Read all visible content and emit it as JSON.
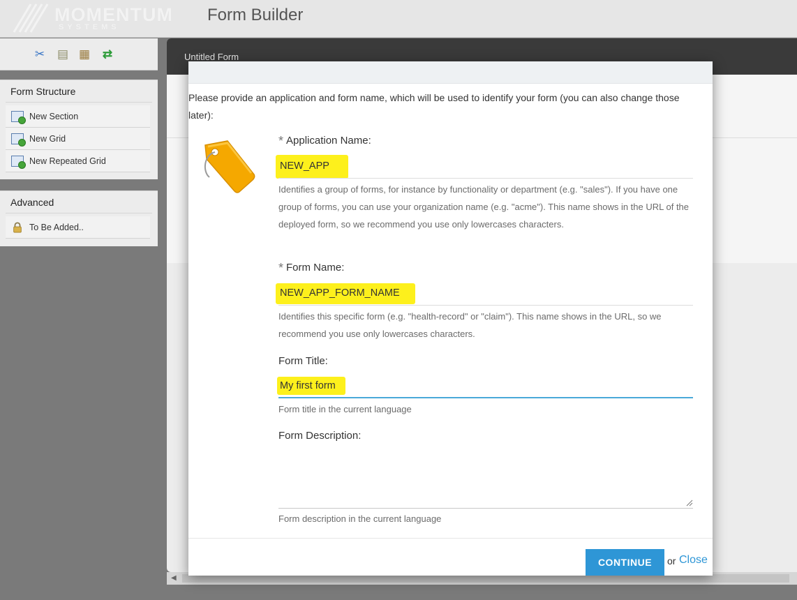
{
  "header": {
    "logo_brand": "MOMENTUM",
    "logo_sub": "SYSTEMS",
    "title": "Form Builder"
  },
  "toolbar": {
    "icons": [
      "cut-icon",
      "copy-icon",
      "paste-icon",
      "refresh-icon"
    ]
  },
  "sidebar": {
    "structure_title": "Form Structure",
    "structure_items": [
      {
        "label": "New Section",
        "icon": "new-section-icon"
      },
      {
        "label": "New Grid",
        "icon": "new-grid-icon"
      },
      {
        "label": "New Repeated Grid",
        "icon": "new-repeated-grid-icon"
      }
    ],
    "advanced_title": "Advanced",
    "advanced_items": [
      {
        "label": "To Be Added..",
        "icon": "lock-icon"
      }
    ]
  },
  "main": {
    "tab_label": "Untitled Form"
  },
  "modal": {
    "intro": "Please provide an application and form name, which will be used to identify your form (you can also change those later):",
    "fields": {
      "app_name": {
        "required_mark": "*",
        "label": "Application Name:",
        "value": "NEW_APP",
        "help": "Identifies a group of forms, for instance by functionality or department (e.g. \"sales\"). If you have one group of forms, you can use your organization name (e.g. \"acme\"). This name shows in the URL of the deployed form, so we recommend you use only lowercases characters."
      },
      "form_name": {
        "required_mark": "*",
        "label": "Form Name:",
        "value": "NEW_APP_FORM_NAME",
        "help": "Identifies this specific form (e.g. \"health-record\" or \"claim\"). This name shows in the URL, so we recommend you use only lowercases characters."
      },
      "form_title": {
        "label": "Form Title:",
        "value": "My first form",
        "help": "Form title in the current language"
      },
      "form_description": {
        "label": "Form Description:",
        "value": "",
        "help": "Form description in the current language"
      }
    },
    "continue_label": "CONTINUE",
    "or_text": "or",
    "close_label": "Close",
    "colors": {
      "accent": "#2e96d6",
      "highlight": "#fdf01c",
      "focus_underline": "#4aa9d9"
    }
  }
}
